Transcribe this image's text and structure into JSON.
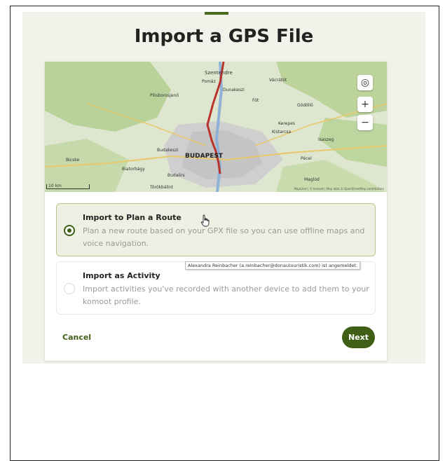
{
  "dialog": {
    "title": "Import a GPS File",
    "cancel_label": "Cancel",
    "next_label": "Next"
  },
  "map": {
    "city_label": "BUDAPEST",
    "place_labels": [
      "Szentendre",
      "Pomáz",
      "Dunakeszi",
      "Vácrátót",
      "Pilisborosjenő",
      "Fót",
      "Gödöllő",
      "Kerepes",
      "Kistarcsa",
      "Isaszeg",
      "Budakeszi",
      "Pécel",
      "Biatorbágy",
      "Budaörs",
      "Törökbálint",
      "Maglód",
      "Bicske"
    ],
    "scale_label": "10 km",
    "attribution": "MapLibre | © komoot | Map data © OpenStreetMap contributors",
    "locate_icon": "locate-icon",
    "zoom_in": "+",
    "zoom_out": "−",
    "route_color": "#b8332a"
  },
  "options": [
    {
      "title": "Import to Plan a Route",
      "description": "Plan a new route based on your GPX file so you can use offline maps and voice navigation.",
      "selected": true
    },
    {
      "title": "Import as Activity",
      "description": "Import activities you've recorded with another device to add them to your komoot profile.",
      "selected": false
    }
  ],
  "tooltip": "Alexandra Reinbacher (a.reinbacher@donautouristik.com) ist angemeldet.",
  "colors": {
    "accent": "#3f5f17",
    "panel_bg": "#f2f1ea",
    "selected_bg": "#eef0e3"
  }
}
